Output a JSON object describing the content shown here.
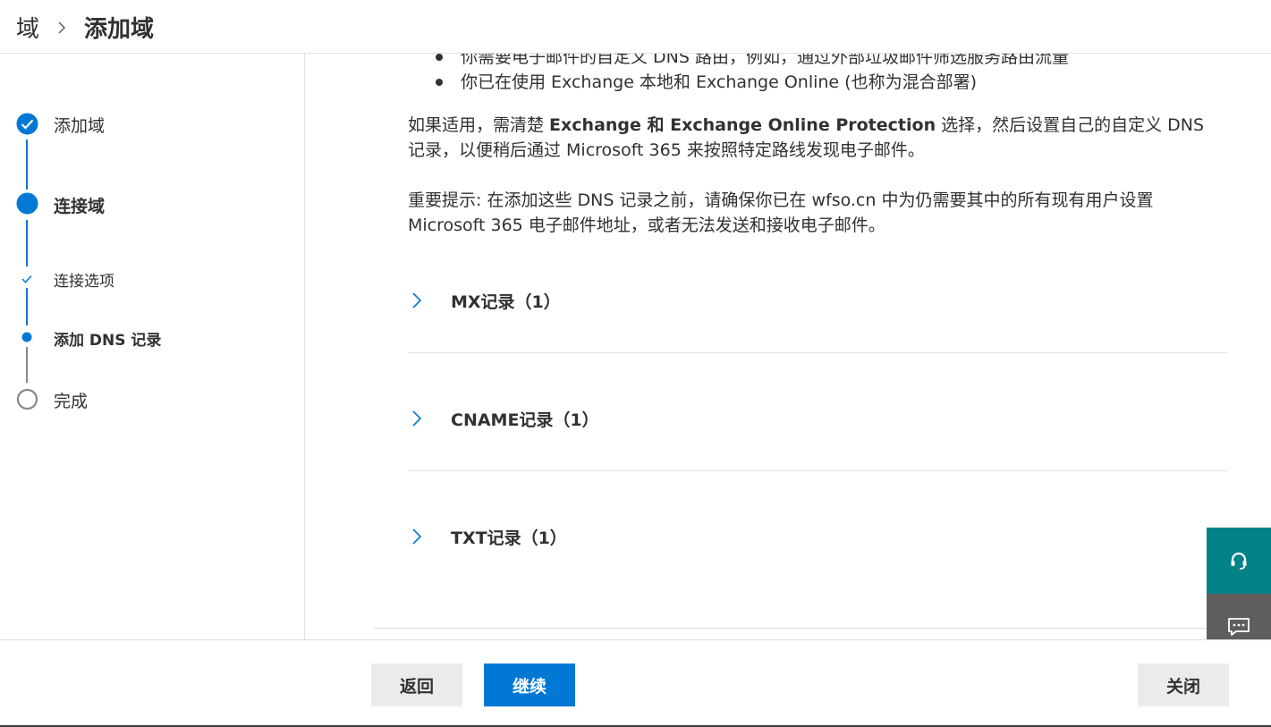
{
  "header": {
    "breadcrumb_parent": "域",
    "breadcrumb_current": "添加域"
  },
  "steps": [
    {
      "label": "添加域",
      "state": "completed"
    },
    {
      "label": "连接域",
      "state": "current"
    },
    {
      "label": "连接选项",
      "state": "sub-completed"
    },
    {
      "label": "添加 DNS 记录",
      "state": "sub-current"
    },
    {
      "label": "完成",
      "state": "pending"
    }
  ],
  "content": {
    "bullets": [
      "你需要电子邮件的自定义 DNS 路由，例如，通过外部垃圾邮件筛选服务路由流量",
      "你已在使用 Exchange 本地和 Exchange Online (也称为混合部署)"
    ],
    "para1_prefix": "如果适用，需清楚 ",
    "para1_bold": "Exchange 和 Exchange Online Protection",
    "para1_suffix": " 选择，然后设置自己的自定义 DNS 记录，以便稍后通过 Microsoft 365 来按照特定路线发现电子邮件。",
    "para2": "重要提示: 在添加这些 DNS 记录之前，请确保你已在 wfso.cn 中为仍需要其中的所有现有用户设置 Microsoft 365 电子邮件地址，或者无法发送和接收电子邮件。"
  },
  "accordion": [
    {
      "title": "MX记录（1）"
    },
    {
      "title": "CNAME记录（1）"
    },
    {
      "title": "TXT记录（1）"
    }
  ],
  "footer": {
    "back_label": "返回",
    "next_label": "继续",
    "close_label": "关闭"
  },
  "colors": {
    "accent": "#0078d4",
    "support": "#038387",
    "feedback": "#605e5c"
  },
  "icons": {
    "support": "headset-icon",
    "feedback": "chat-icon"
  }
}
